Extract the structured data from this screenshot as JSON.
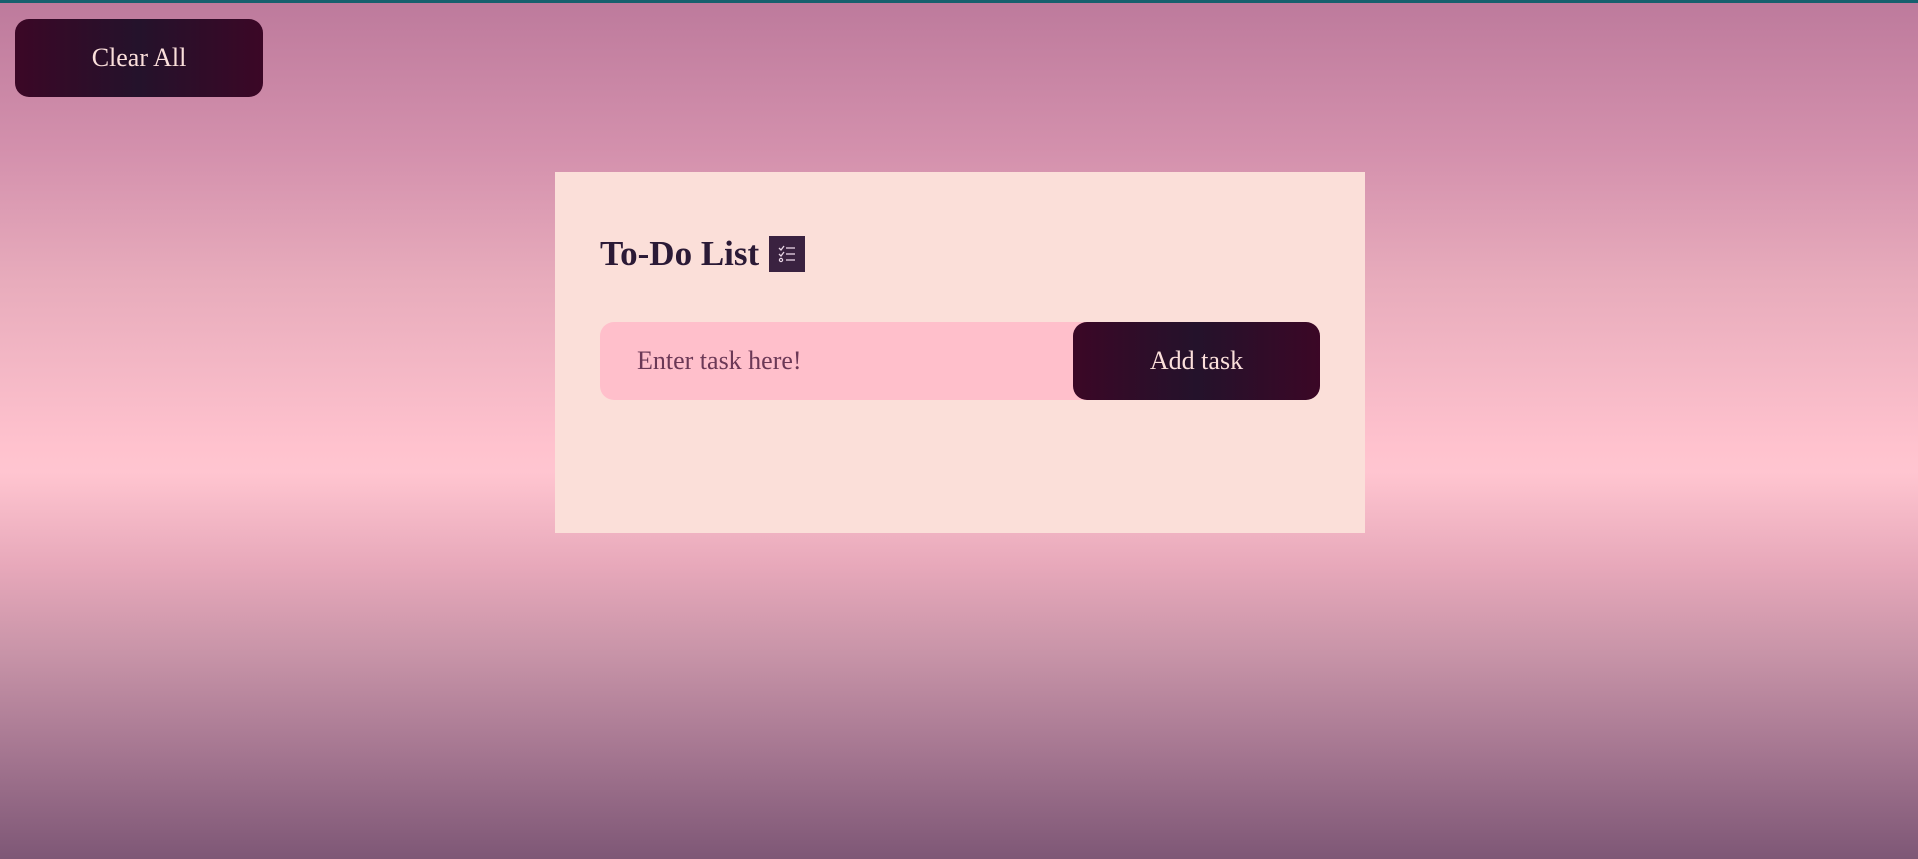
{
  "toolbar": {
    "clear_all_label": "Clear All"
  },
  "card": {
    "title": "To-Do List",
    "title_icon": "checklist-icon",
    "input": {
      "placeholder": "Enter task here!",
      "value": ""
    },
    "add_button_label": "Add task",
    "tasks": []
  },
  "colors": {
    "button_dark": "#2a0d26",
    "button_text": "#fbdfdb",
    "card_bg": "#fbdfd9",
    "input_bg": "#ffbfcb",
    "title_text": "#2b1a36",
    "top_border": "#16606e"
  }
}
